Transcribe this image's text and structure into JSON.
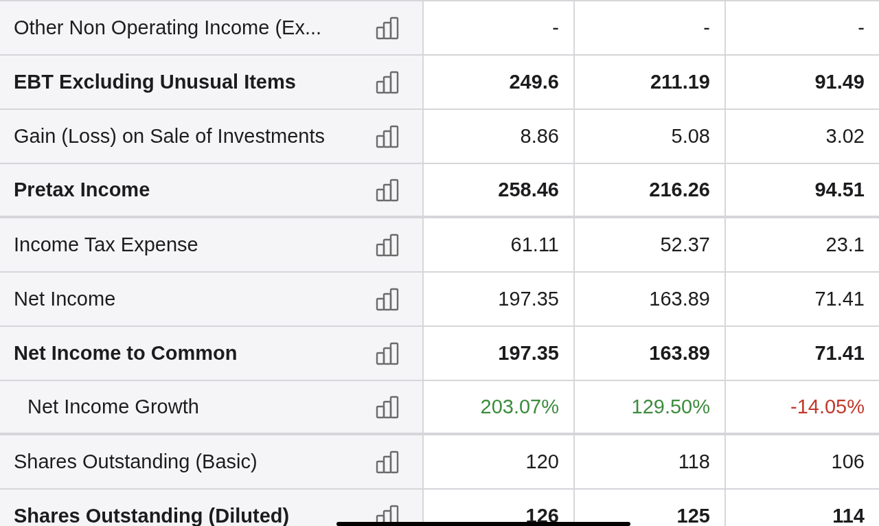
{
  "rows": [
    {
      "label": "Other Non Operating Income (Ex...",
      "bold": false,
      "divider_after": false,
      "values": [
        {
          "text": "-"
        },
        {
          "text": "-"
        },
        {
          "text": "-"
        }
      ]
    },
    {
      "label": "EBT Excluding Unusual Items",
      "bold": true,
      "divider_after": false,
      "values": [
        {
          "text": "249.6"
        },
        {
          "text": "211.19"
        },
        {
          "text": "91.49"
        }
      ]
    },
    {
      "label": "Gain (Loss) on Sale of Investments",
      "bold": false,
      "divider_after": false,
      "values": [
        {
          "text": "8.86"
        },
        {
          "text": "5.08"
        },
        {
          "text": "3.02"
        }
      ]
    },
    {
      "label": "Pretax Income",
      "bold": true,
      "divider_after": true,
      "values": [
        {
          "text": "258.46"
        },
        {
          "text": "216.26"
        },
        {
          "text": "94.51"
        }
      ]
    },
    {
      "label": "Income Tax Expense",
      "bold": false,
      "divider_after": false,
      "values": [
        {
          "text": "61.11"
        },
        {
          "text": "52.37"
        },
        {
          "text": "23.1"
        }
      ]
    },
    {
      "label": "Net Income",
      "bold": false,
      "divider_after": false,
      "values": [
        {
          "text": "197.35"
        },
        {
          "text": "163.89"
        },
        {
          "text": "71.41"
        }
      ]
    },
    {
      "label": "Net Income to Common",
      "bold": true,
      "divider_after": false,
      "values": [
        {
          "text": "197.35"
        },
        {
          "text": "163.89"
        },
        {
          "text": "71.41"
        }
      ],
      "children": [
        {
          "label": "Net Income Growth",
          "bold": false,
          "divider_after": true,
          "values": [
            {
              "text": "203.07%",
              "color": "#3d8b3d"
            },
            {
              "text": "129.50%",
              "color": "#3d8b3d"
            },
            {
              "text": "-14.05%",
              "color": "#c0392b"
            }
          ]
        }
      ]
    },
    {
      "label": "Shares Outstanding (Basic)",
      "bold": false,
      "divider_after": false,
      "values": [
        {
          "text": "120"
        },
        {
          "text": "118"
        },
        {
          "text": "106"
        }
      ]
    },
    {
      "label": "Shares Outstanding (Diluted)",
      "bold": true,
      "divider_after": false,
      "values": [
        {
          "text": "126"
        },
        {
          "text": "125"
        },
        {
          "text": "114"
        }
      ]
    }
  ]
}
